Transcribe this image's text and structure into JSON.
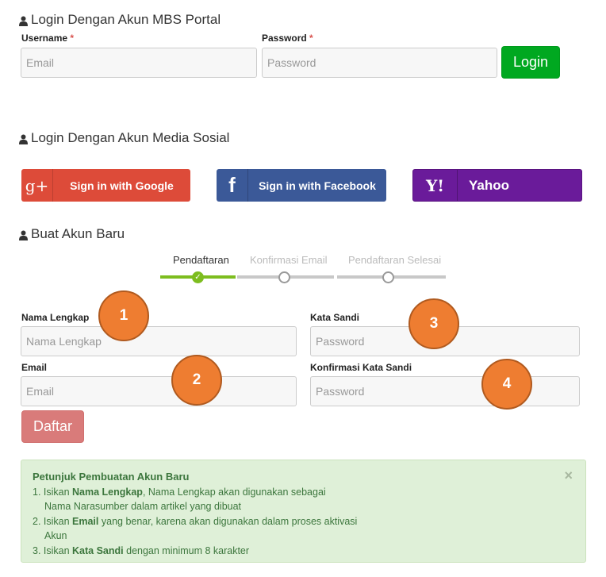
{
  "portal_login": {
    "title": "Login Dengan Akun MBS Portal",
    "username_label": "Username",
    "password_label": "Password",
    "required_mark": "*",
    "email_placeholder": "Email",
    "password_placeholder": "Password",
    "login_button": "Login"
  },
  "social_login": {
    "title": "Login Dengan Akun Media Sosial",
    "google": {
      "icon": "g+",
      "label": "Sign in with Google",
      "color": "#dd4b39"
    },
    "facebook": {
      "icon": "f",
      "label": "Sign in with Facebook",
      "color": "#3b5998"
    },
    "yahoo": {
      "icon": "Y!",
      "label": "Yahoo",
      "color": "#6a1b9a"
    }
  },
  "register": {
    "title": "Buat Akun Baru",
    "steps": [
      "Pendaftaran",
      "Konfirmasi Email",
      "Pendaftaran Selesai"
    ],
    "active_step": 0,
    "fields": {
      "nama_label": "Nama Lengkap",
      "nama_placeholder": "Nama Lengkap",
      "email_label": "Email",
      "email_placeholder": "Email",
      "katasandi_label": "Kata Sandi",
      "katasandi_placeholder": "Password",
      "konfirmasi_label": "Konfirmasi Kata Sandi",
      "konfirmasi_placeholder": "Password"
    },
    "submit_button": "Daftar",
    "badges": [
      "1",
      "2",
      "3",
      "4"
    ]
  },
  "instructions": {
    "title": "Petunjuk Pembuatan Akun Baru",
    "close": "×",
    "item1_prefix": "1. Isikan ",
    "item1_bold": "Nama Lengkap",
    "item1_rest": ", Nama Lengkap akan digunakan sebagai",
    "item1_line2": "Nama Narasumber dalam artikel yang dibuat",
    "item2_prefix": "2. Isikan ",
    "item2_bold": "Email",
    "item2_rest": " yang benar, karena akan digunakan dalam proses aktivasi",
    "item2_line2": "Akun",
    "item3_prefix": "3. Isikan ",
    "item3_bold": "Kata Sandi",
    "item3_rest": " dengan minimum 8 karakter"
  },
  "colors": {
    "login_green": "#00a820",
    "step_done": "#7dbd1f",
    "badge_orange": "#ee7d31",
    "alert_bg": "#dff0d8"
  }
}
